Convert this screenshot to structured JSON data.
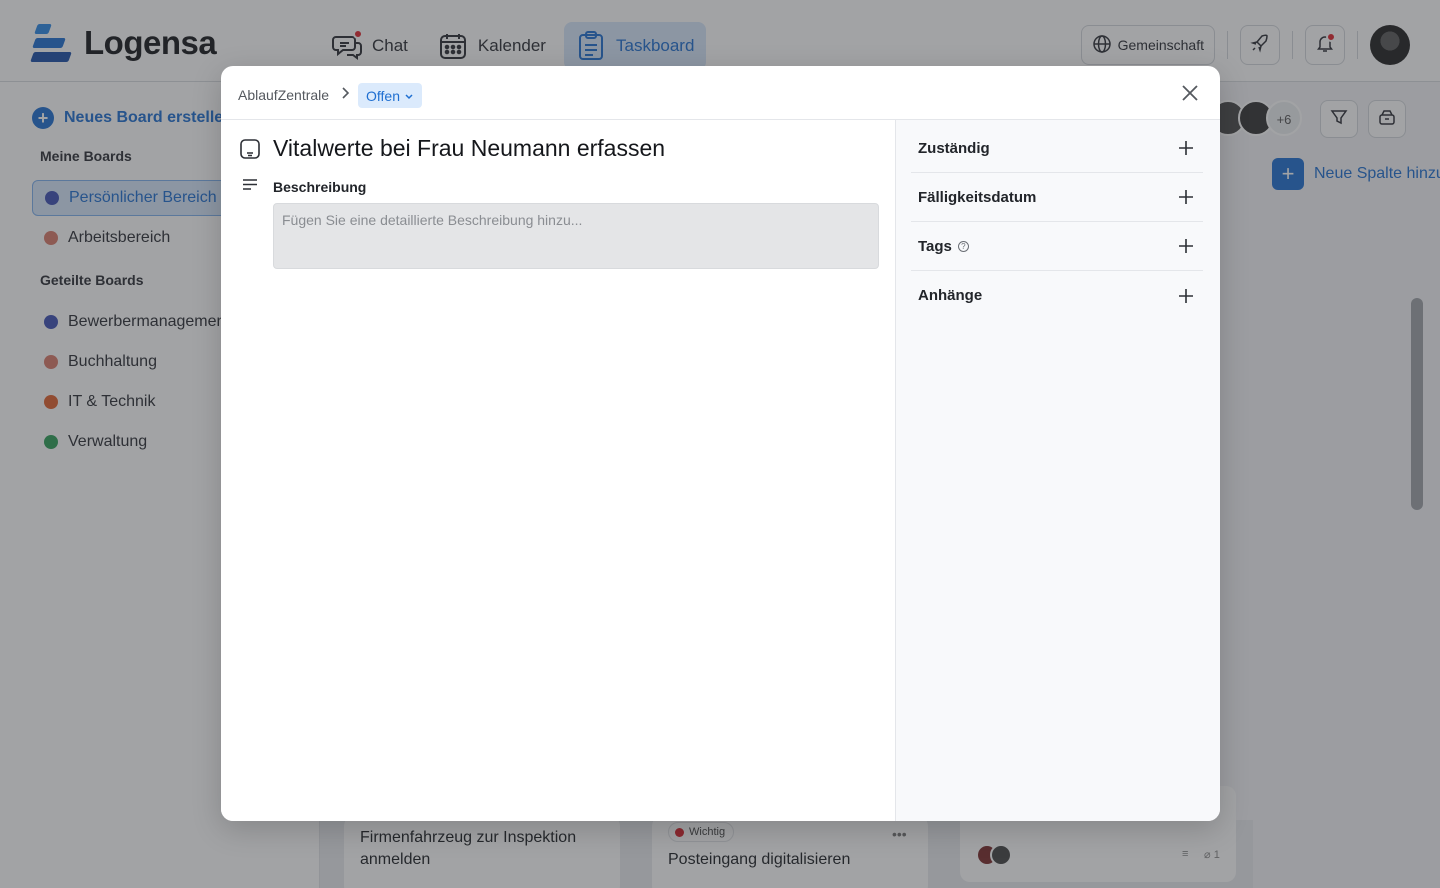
{
  "app": {
    "name": "Logensa"
  },
  "nav": {
    "chat": "Chat",
    "calendar": "Kalender",
    "taskboard": "Taskboard"
  },
  "top_right": {
    "community": "Gemeinschaft"
  },
  "sidebar": {
    "new_board": "Neues Board erstellen",
    "my_boards_title": "Meine Boards",
    "my_boards": [
      {
        "label": "Persönlicher Bereich",
        "color": "#3f51b5"
      },
      {
        "label": "Arbeitsbereich",
        "color": "#d97a6b"
      }
    ],
    "shared_boards_title": "Geteilte Boards",
    "shared_boards": [
      {
        "label": "Bewerbermanagement",
        "color": "#3f51b5"
      },
      {
        "label": "Buchhaltung",
        "color": "#d97a6b"
      },
      {
        "label": "IT & Technik",
        "color": "#e0622f"
      },
      {
        "label": "Verwaltung",
        "color": "#2e9e58"
      }
    ]
  },
  "board": {
    "member_extra": "+6",
    "new_column": "Neue Spalte hinzufügen",
    "cards": [
      {
        "title": "Firmenfahrzeug zur Inspektion anmelden"
      },
      {
        "tag": "Wichtig",
        "title": "Posteingang digitalisieren"
      },
      {
        "attachments": "1"
      }
    ]
  },
  "modal": {
    "breadcrumb_root": "AblaufZentrale",
    "status": "Offen",
    "title": "Vitalwerte bei Frau Neumann erfassen",
    "description_label": "Beschreibung",
    "description_placeholder": "Fügen Sie eine detaillierte Beschreibung hinzu...",
    "side": {
      "assignee": "Zuständig",
      "due_date": "Fälligkeitsdatum",
      "tags": "Tags",
      "attachments": "Anhänge"
    }
  },
  "colors": {
    "accent": "#1f6fd1",
    "accent_soft": "#d7e7fb",
    "notification": "#e0262e"
  }
}
